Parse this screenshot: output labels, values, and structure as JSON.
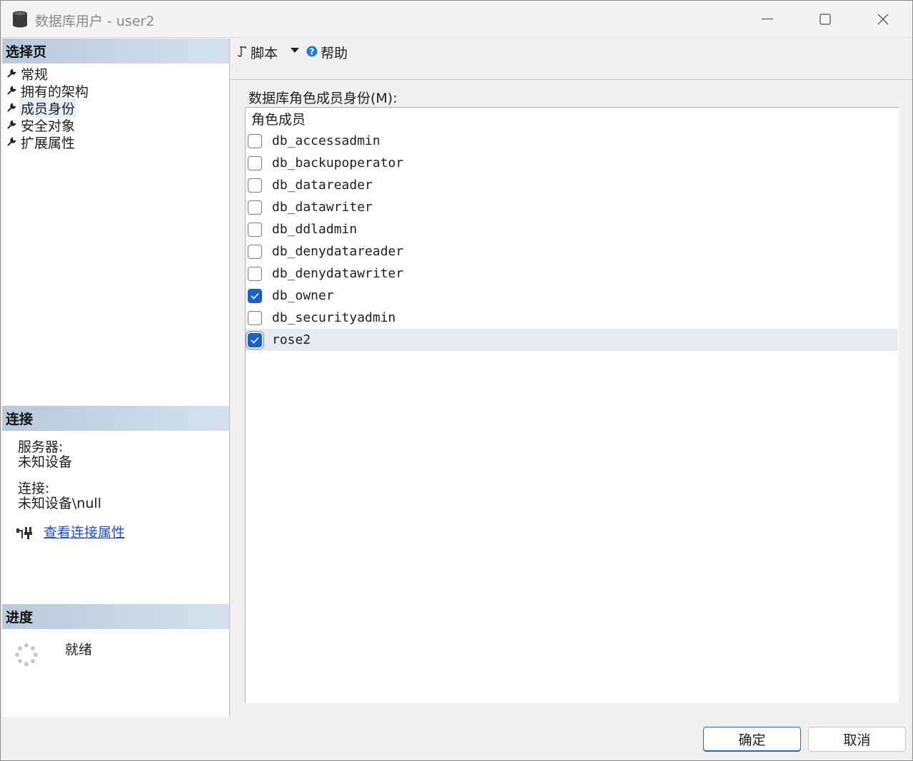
{
  "window": {
    "title": "数据库用户 - user2",
    "icons": {
      "app": "database-icon",
      "minimize": "minimize-icon",
      "maximize": "maximize-icon",
      "close": "close-icon"
    }
  },
  "left_pane": {
    "select_page_header": "选择页",
    "nav_items": [
      {
        "label": "常规",
        "icon": "wrench-icon",
        "selected": false
      },
      {
        "label": "拥有的架构",
        "icon": "wrench-icon",
        "selected": false
      },
      {
        "label": "成员身份",
        "icon": "wrench-icon",
        "selected": true
      },
      {
        "label": "安全对象",
        "icon": "wrench-icon",
        "selected": false
      },
      {
        "label": "扩展属性",
        "icon": "wrench-icon",
        "selected": false
      }
    ],
    "connection_header": "连接",
    "server_label": "服务器:",
    "server_value": "未知设备",
    "connection_label": "连接:",
    "connection_value": "未知设备\\null",
    "view_connection_link": "查看连接属性",
    "progress_header": "进度",
    "progress_status": "就绪"
  },
  "toolbar": {
    "script_label": "脚本",
    "help_label": "帮助"
  },
  "main": {
    "list_label": "数据库角色成员身份(M):",
    "column_header": "角色成员",
    "roles": [
      {
        "name": "db_accessadmin",
        "checked": false
      },
      {
        "name": "db_backupoperator",
        "checked": false
      },
      {
        "name": "db_datareader",
        "checked": false
      },
      {
        "name": "db_datawriter",
        "checked": false
      },
      {
        "name": "db_ddladmin",
        "checked": false
      },
      {
        "name": "db_denydatareader",
        "checked": false
      },
      {
        "name": "db_denydatawriter",
        "checked": false
      },
      {
        "name": "db_owner",
        "checked": true
      },
      {
        "name": "db_securityadmin",
        "checked": false
      },
      {
        "name": "rose2",
        "checked": true,
        "selected": true
      }
    ]
  },
  "buttons": {
    "ok": "确定",
    "cancel": "取消"
  },
  "colors": {
    "accent": "#1b62c4",
    "link": "#1a4dd9",
    "header_gradient_start": "#b9c9db",
    "header_gradient_end": "#d5e1ee"
  }
}
